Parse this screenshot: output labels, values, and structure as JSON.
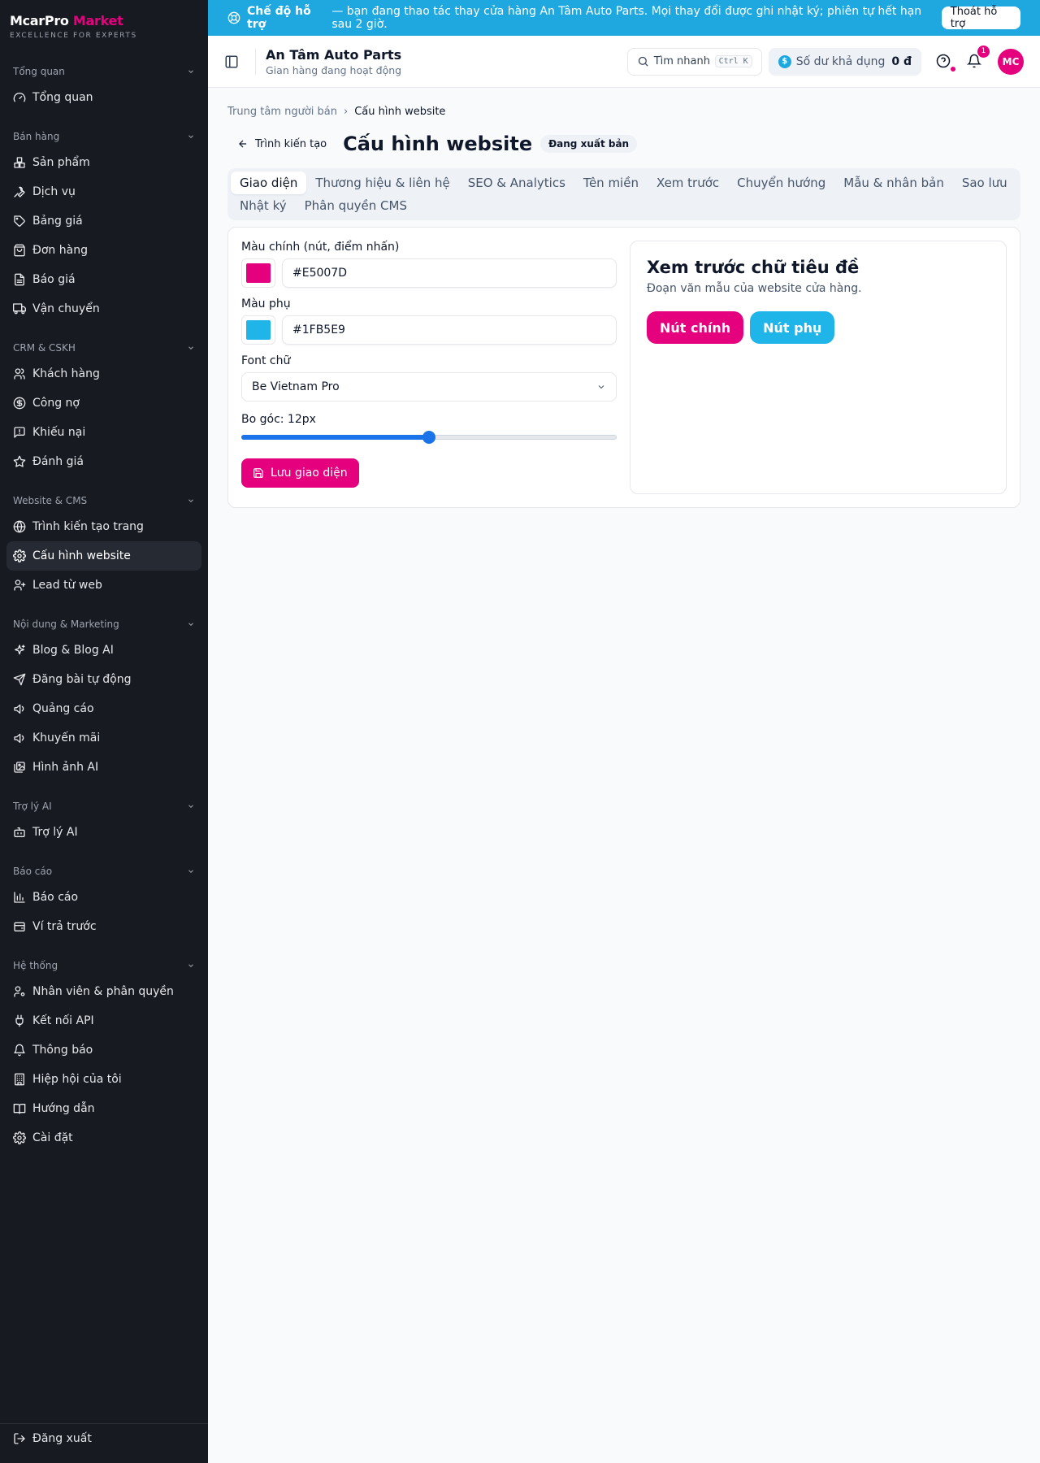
{
  "brand": {
    "name": "McarPro",
    "name_accent": "Market",
    "tagline": "EXCELLENCE FOR EXPERTS"
  },
  "sidebar": {
    "sections": [
      {
        "label": "Tổng quan",
        "items": [
          {
            "label": "Tổng quan",
            "icon": "gauge-icon"
          }
        ]
      },
      {
        "label": "Bán hàng",
        "items": [
          {
            "label": "Sản phẩm",
            "icon": "boxes-icon"
          },
          {
            "label": "Dịch vụ",
            "icon": "wrench-icon"
          },
          {
            "label": "Bảng giá",
            "icon": "tag-icon"
          },
          {
            "label": "Đơn hàng",
            "icon": "bag-icon"
          },
          {
            "label": "Báo giá",
            "icon": "file-icon"
          },
          {
            "label": "Vận chuyển",
            "icon": "truck-icon"
          }
        ]
      },
      {
        "label": "CRM & CSKH",
        "items": [
          {
            "label": "Khách hàng",
            "icon": "users-icon"
          },
          {
            "label": "Công nợ",
            "icon": "dollar-icon"
          },
          {
            "label": "Khiếu nại",
            "icon": "message-alert-icon"
          },
          {
            "label": "Đánh giá",
            "icon": "star-icon"
          }
        ]
      },
      {
        "label": "Website & CMS",
        "items": [
          {
            "label": "Trình kiến tạo trang",
            "icon": "globe-icon"
          },
          {
            "label": "Cấu hình website",
            "icon": "gear-icon",
            "active": true
          },
          {
            "label": "Lead từ web",
            "icon": "user-plus-icon"
          }
        ]
      },
      {
        "label": "Nội dung & Marketing",
        "items": [
          {
            "label": "Blog & Blog AI",
            "icon": "sparkles-icon"
          },
          {
            "label": "Đăng bài tự động",
            "icon": "send-icon"
          },
          {
            "label": "Quảng cáo",
            "icon": "megaphone-icon"
          },
          {
            "label": "Khuyến mãi",
            "icon": "megaphone-icon"
          },
          {
            "label": "Hình ảnh AI",
            "icon": "images-icon"
          }
        ]
      },
      {
        "label": "Trợ lý AI",
        "items": [
          {
            "label": "Trợ lý AI",
            "icon": "bot-icon"
          }
        ]
      },
      {
        "label": "Báo cáo",
        "items": [
          {
            "label": "Báo cáo",
            "icon": "chart-icon"
          },
          {
            "label": "Ví trả trước",
            "icon": "wallet-icon"
          }
        ]
      },
      {
        "label": "Hệ thống",
        "items": [
          {
            "label": "Nhân viên & phân quyền",
            "icon": "user-cog-icon"
          },
          {
            "label": "Kết nối API",
            "icon": "plug-icon"
          },
          {
            "label": "Thông báo",
            "icon": "bell-icon"
          },
          {
            "label": "Hiệp hội của tôi",
            "icon": "building-icon"
          },
          {
            "label": "Hướng dẫn",
            "icon": "book-icon"
          },
          {
            "label": "Cài đặt",
            "icon": "gear-icon"
          }
        ]
      }
    ],
    "logout": "Đăng xuất"
  },
  "banner": {
    "strong": "Chế độ hỗ trợ",
    "text": "— bạn đang thao tác thay cửa hàng An Tâm Auto Parts. Mọi thay đổi được ghi nhật ký; phiên tự hết hạn sau 2 giờ.",
    "button": "Thoát hỗ trợ"
  },
  "topbar": {
    "store_name": "An Tâm Auto Parts",
    "store_status": "Gian hàng đang hoạt động",
    "search_label": "Tìm nhanh",
    "search_kbd": "Ctrl K",
    "balance_label": "Số dư khả dụng",
    "balance_value": "0 đ",
    "notif_count": "1",
    "avatar": "MC"
  },
  "breadcrumb": {
    "root": "Trung tâm người bán",
    "current": "Cấu hình website"
  },
  "page": {
    "back": "Trình kiến tạo",
    "title": "Cấu hình website",
    "status": "Đang xuất bản"
  },
  "tabs": [
    "Giao diện",
    "Thương hiệu & liên hệ",
    "SEO & Analytics",
    "Tên miền",
    "Xem trước",
    "Chuyển hướng",
    "Mẫu & nhân bản",
    "Sao lưu",
    "Nhật ký",
    "Phân quyền CMS"
  ],
  "form": {
    "primary_label": "Màu chính (nút, điểm nhấn)",
    "primary_value": "#E5007D",
    "secondary_label": "Màu phụ",
    "secondary_value": "#1FB5E9",
    "font_label": "Font chữ",
    "font_value": "Be Vietnam Pro",
    "radius_label": "Bo góc: 12px",
    "radius_fraction": 0.5,
    "save": "Lưu giao diện"
  },
  "preview": {
    "title": "Xem trước chữ tiêu đề",
    "subtitle": "Đoạn văn mẫu của website cửa hàng.",
    "primary_btn": "Nút chính",
    "secondary_btn": "Nút phụ"
  },
  "colors": {
    "accent": "#E5007D",
    "secondary": "#1FB5E9",
    "sidebar": "#171A20"
  }
}
